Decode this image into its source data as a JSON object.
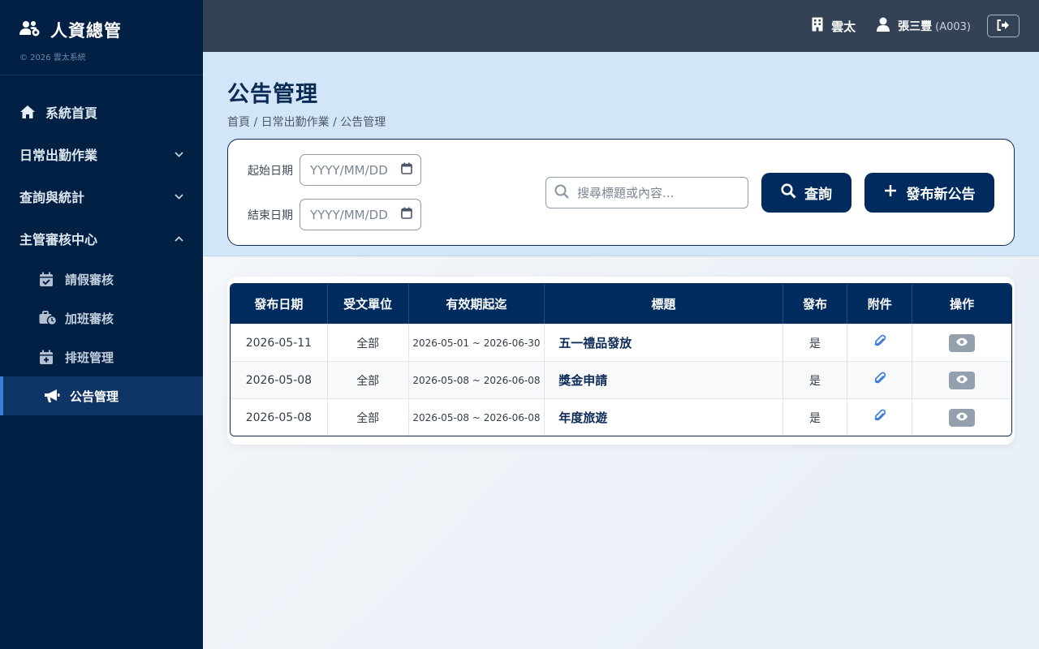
{
  "brand": {
    "title": "人資總管",
    "copyright": "© 2026 雲太系統",
    "icon": "users-gear-icon"
  },
  "sidebar": {
    "items": [
      {
        "label": "系統首頁",
        "icon": "home-icon"
      },
      {
        "label": "日常出勤作業",
        "expanded": false
      },
      {
        "label": "查詢與統計",
        "expanded": false
      },
      {
        "label": "主管審核中心",
        "expanded": true
      }
    ],
    "sub_items": [
      {
        "label": "請假審核",
        "icon": "calendar-check-icon"
      },
      {
        "label": "加班審核",
        "icon": "briefcase-clock-icon"
      },
      {
        "label": "排班管理",
        "icon": "calendar-plus-icon"
      },
      {
        "label": "公告管理",
        "icon": "megaphone-icon",
        "active": true
      }
    ]
  },
  "topbar": {
    "company": "雲太",
    "user_name": "張三豐",
    "user_code": "(A003)"
  },
  "page": {
    "title": "公告管理",
    "breadcrumb": "首頁 / 日常出勤作業 / 公告管理"
  },
  "filters": {
    "start_label": "起始日期",
    "end_label": "結束日期",
    "start_placeholder": "YYYY/MM/DD",
    "end_placeholder": "YYYY/MM/DD",
    "search_placeholder": "搜尋標題或內容...",
    "query_label": "查詢",
    "publish_label": "發布新公告"
  },
  "table": {
    "headers": [
      "發布日期",
      "受文單位",
      "有效期起迄",
      "標題",
      "發布",
      "附件",
      "操作"
    ],
    "rows": [
      {
        "date": "2026-05-11",
        "unit": "全部",
        "range": "2026-05-01 ~ 2026-06-30",
        "title": "五一禮品發放",
        "published": "是"
      },
      {
        "date": "2026-05-08",
        "unit": "全部",
        "range": "2026-05-08 ~ 2026-06-08",
        "title": "獎金申請",
        "published": "是"
      },
      {
        "date": "2026-05-08",
        "unit": "全部",
        "range": "2026-05-08 ~ 2026-06-08",
        "title": "年度旅遊",
        "published": "是"
      }
    ]
  },
  "colors": {
    "sidebar_bg": "#012044",
    "topbar_bg": "#344256",
    "header_bg": "#d3e5f8",
    "primary": "#012b5e",
    "active_accent": "#3b7ddd",
    "attachment_icon": "#3b7ddd"
  }
}
